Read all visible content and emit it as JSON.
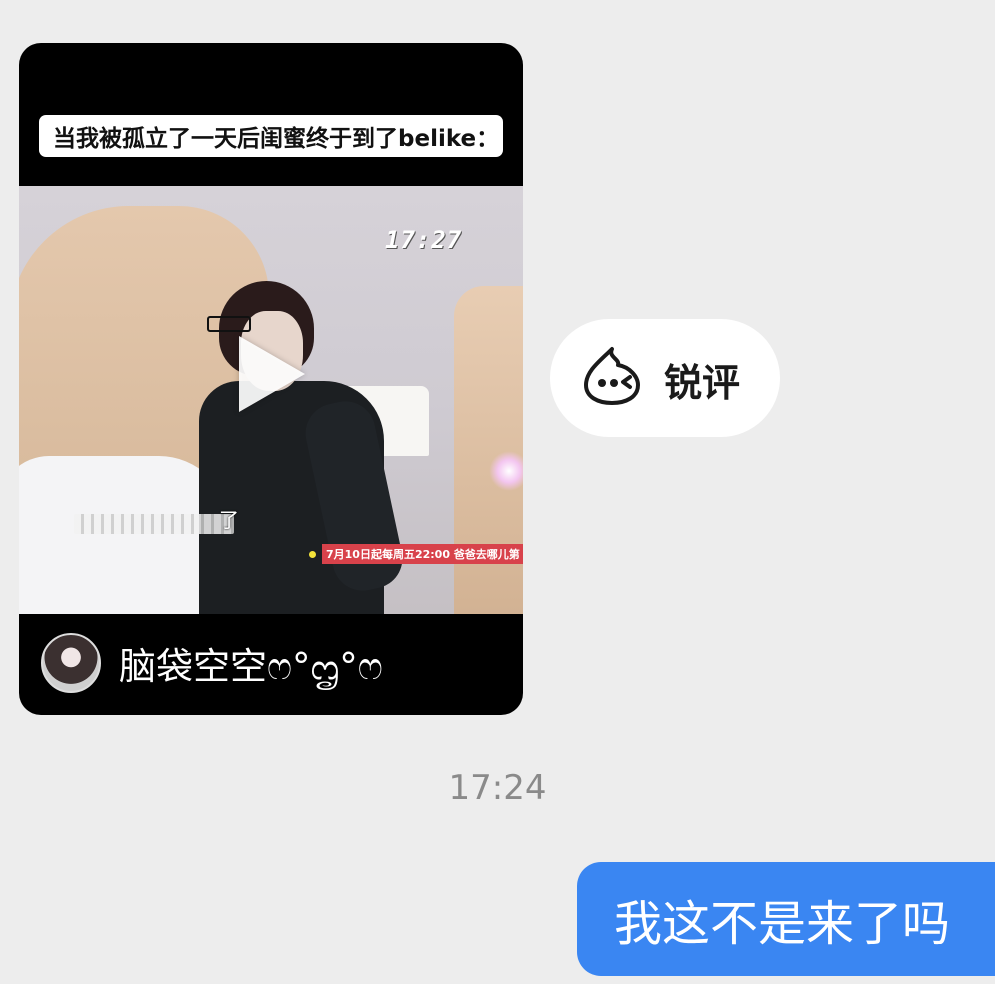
{
  "video_card": {
    "caption": "当我被孤立了一天后闺蜜终于到了belike：",
    "video_clock": "17:27",
    "subtitle_tail": "了",
    "promo_text": "7月10日起每周五22:00  爸爸去哪儿第",
    "author_name": "脑袋空空ෆ°ᦗ°ෆ"
  },
  "reaction": {
    "label": "锐评",
    "icon": "drop-face-icon"
  },
  "timestamp": "17:24",
  "message": {
    "text": "我这不是来了吗",
    "bubble_color": "#3a86f2"
  }
}
